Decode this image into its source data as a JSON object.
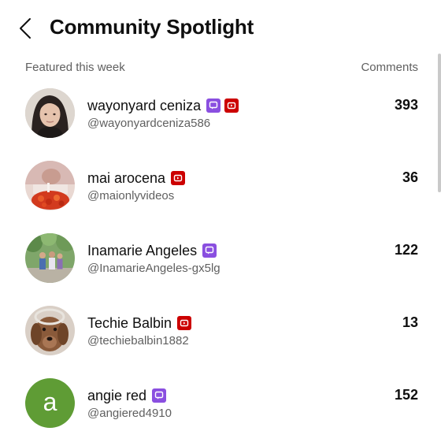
{
  "header": {
    "title": "Community Spotlight",
    "back_icon": "chevron-left-icon"
  },
  "subheader": {
    "left_label": "Featured this week",
    "right_label": "Comments"
  },
  "rows": [
    {
      "name": "wayonyard ceniza",
      "handle": "@wayonyardceniza586",
      "count": "393",
      "badges": [
        "member-badge-icon",
        "youtube-badge-icon"
      ],
      "avatar": "photo-portrait"
    },
    {
      "name": "mai arocena",
      "handle": "@maionlyvideos",
      "count": "36",
      "badges": [
        "youtube-badge-icon"
      ],
      "avatar": "photo-food"
    },
    {
      "name": "Inamarie Angeles",
      "handle": "@InamarieAngeles-gx5lg",
      "count": "122",
      "badges": [
        "member-badge-icon"
      ],
      "avatar": "photo-outdoor-group"
    },
    {
      "name": "Techie Balbin",
      "handle": "@techiebalbin1882",
      "count": "13",
      "badges": [
        "youtube-badge-icon"
      ],
      "avatar": "photo-dog"
    },
    {
      "name": "angie red",
      "handle": "@angiered4910",
      "count": "152",
      "badges": [
        "member-badge-icon"
      ],
      "avatar": "letter-a",
      "avatar_letter": "a",
      "avatar_color": "#5f9c35"
    }
  ],
  "colors": {
    "member_badge": "#8a4fe0",
    "youtube_badge": "#cc0000",
    "secondary_text": "#606060"
  }
}
